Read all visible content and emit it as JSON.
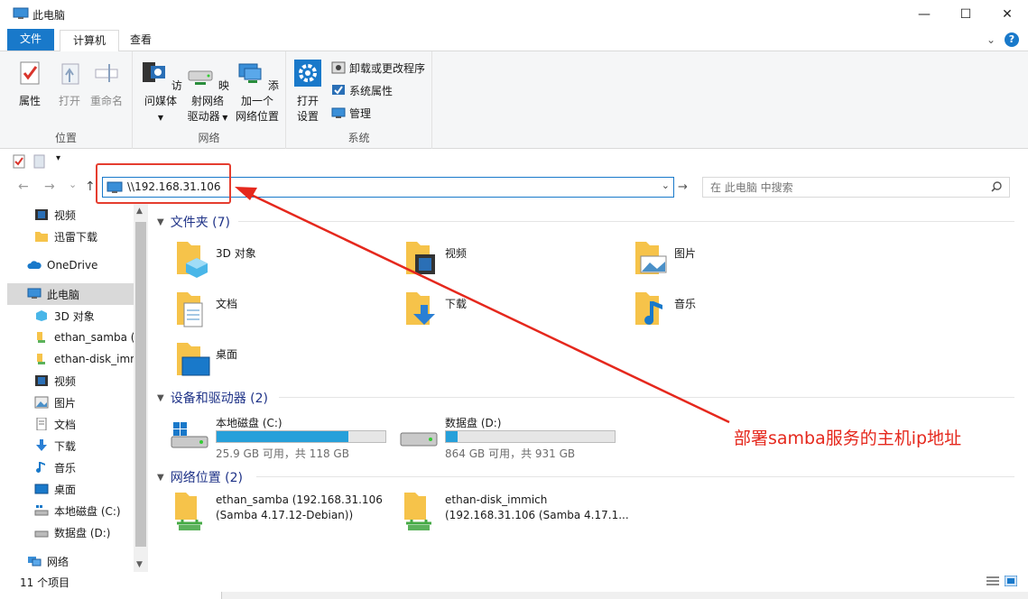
{
  "window": {
    "title": "此电脑",
    "minimize": "—",
    "maximize": "☐",
    "close": "✕"
  },
  "tabs": {
    "file": "文件",
    "computer": "计算机",
    "view": "查看",
    "collapse": "⌄",
    "help": "?"
  },
  "ribbon": {
    "location": {
      "label": "位置",
      "properties": "属性",
      "open": "打开",
      "rename": "重命名"
    },
    "network": {
      "label": "网络",
      "access_media_1": "访问媒体",
      "map_drive_1": "映射网络",
      "map_drive_2": "驱动器",
      "add_location_1": "添加一个",
      "add_location_2": "网络位置"
    },
    "system": {
      "label": "系统",
      "open_settings_1": "打开",
      "open_settings_2": "设置",
      "uninstall": "卸载或更改程序",
      "sys_props": "系统属性",
      "manage": "管理"
    }
  },
  "address": {
    "back": "←",
    "forward": "→",
    "recent": "⌄",
    "up": "↑",
    "path": "\\\\192.168.31.106",
    "dropdown": "⌄",
    "go": "→"
  },
  "search": {
    "placeholder": "在 此电脑 中搜索"
  },
  "nav_pane": {
    "items": [
      "视频",
      "迅雷下载",
      "OneDrive",
      "此电脑",
      "3D 对象",
      "ethan_samba (\\",
      "ethan-disk_imm",
      "视频",
      "图片",
      "文档",
      "下载",
      "音乐",
      "桌面",
      "本地磁盘 (C:)",
      "数据盘 (D:)",
      "网络"
    ]
  },
  "sections": {
    "folders": {
      "title": "文件夹 (7)",
      "items": [
        "3D 对象",
        "视频",
        "图片",
        "文档",
        "下载",
        "音乐",
        "桌面"
      ]
    },
    "devices": {
      "title": "设备和驱动器 (2)",
      "drives": [
        {
          "name": "本地磁盘 (C:)",
          "free": "25.9 GB 可用，共 118 GB",
          "used_fraction": 0.78
        },
        {
          "name": "数据盘 (D:)",
          "free": "864 GB 可用，共 931 GB",
          "used_fraction": 0.07
        }
      ]
    },
    "network": {
      "title": "网络位置 (2)",
      "items": [
        {
          "line1": "ethan_samba (192.168.31.106",
          "line2": "(Samba 4.17.12-Debian))"
        },
        {
          "line1": "ethan-disk_immich",
          "line2": "(192.168.31.106 (Samba 4.17.1..."
        }
      ]
    }
  },
  "annotation": {
    "text": "部署samba服务的主机ip地址",
    "color": "#e5281d"
  },
  "status": {
    "count": "11 个项目"
  },
  "colors": {
    "accent": "#1979ca",
    "drive_fill": "#26a0da",
    "folder": "#f6c34a"
  }
}
